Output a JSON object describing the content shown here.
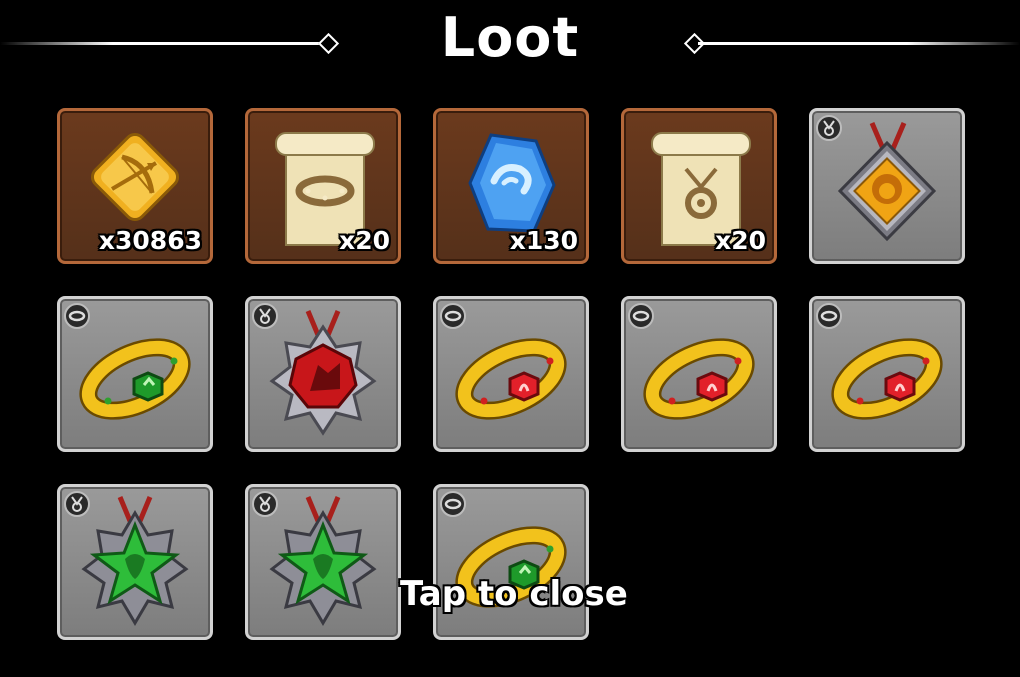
{
  "header": {
    "title": "Loot"
  },
  "footer": {
    "hint": "Tap to close"
  },
  "items": [
    {
      "name": "bow-token",
      "kind": "resource",
      "quantity": "x30863"
    },
    {
      "name": "ring-recipe-scroll",
      "kind": "resource",
      "quantity": "x20"
    },
    {
      "name": "blue-crystal",
      "kind": "resource",
      "quantity": "x130"
    },
    {
      "name": "amulet-recipe-scroll",
      "kind": "resource",
      "quantity": "x20"
    },
    {
      "name": "lion-amulet",
      "kind": "gear",
      "slot": "amulet"
    },
    {
      "name": "green-gem-ring",
      "kind": "gear",
      "slot": "ring"
    },
    {
      "name": "red-wolf-amulet",
      "kind": "gear",
      "slot": "amulet"
    },
    {
      "name": "red-gem-ring",
      "kind": "gear",
      "slot": "ring"
    },
    {
      "name": "red-gem-ring",
      "kind": "gear",
      "slot": "ring"
    },
    {
      "name": "red-gem-ring",
      "kind": "gear",
      "slot": "ring"
    },
    {
      "name": "green-star-amulet",
      "kind": "gear",
      "slot": "amulet"
    },
    {
      "name": "green-star-amulet",
      "kind": "gear",
      "slot": "amulet"
    },
    {
      "name": "green-gem-ring",
      "kind": "gear",
      "slot": "ring"
    }
  ],
  "colors": {
    "resource_frame": "#b4683a",
    "gear_frame": "#d2d2d2",
    "background": "#000000"
  }
}
